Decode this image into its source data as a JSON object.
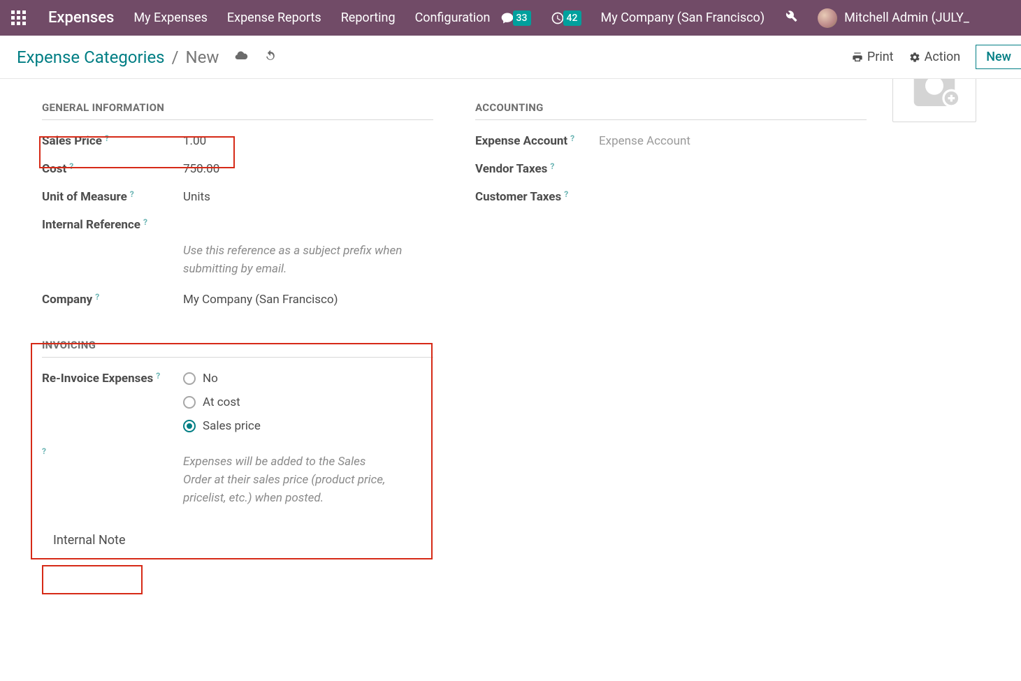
{
  "navbar": {
    "brand": "Expenses",
    "items": [
      "My Expenses",
      "Expense Reports",
      "Reporting",
      "Configuration"
    ],
    "chat_badge": "33",
    "activity_badge": "42",
    "company": "My Company (San Francisco)",
    "user_name": "Mitchell Admin (JULY_"
  },
  "controlbar": {
    "breadcrumb_link": "Expense Categories",
    "breadcrumb_sep": "/",
    "breadcrumb_current": "New",
    "print": "Print",
    "action": "Action",
    "new": "New"
  },
  "form": {
    "section_general": "General Information",
    "section_accounting": "Accounting",
    "section_invoicing": "Invoicing",
    "labels": {
      "sales_price": "Sales Price",
      "cost": "Cost",
      "uom": "Unit of Measure",
      "internal_ref": "Internal Reference",
      "company": "Company",
      "expense_account": "Expense Account",
      "vendor_taxes": "Vendor Taxes",
      "customer_taxes": "Customer Taxes",
      "reinvoice": "Re-Invoice Expenses"
    },
    "values": {
      "sales_price": "1.00",
      "cost": "750.00",
      "uom": "Units",
      "company": "My Company (San Francisco)",
      "expense_account_placeholder": "Expense Account"
    },
    "hints": {
      "internal_ref": "Use this reference as a subject prefix when submitting by email.",
      "reinvoice": "Expenses will be added to the Sales Order at their sales price (product price, pricelist, etc.) when posted."
    },
    "radio": {
      "no": "No",
      "at_cost": "At cost",
      "sales_price": "Sales price",
      "selected": "sales_price"
    },
    "internal_note_tab": "Internal Note",
    "help_marker": "?"
  }
}
